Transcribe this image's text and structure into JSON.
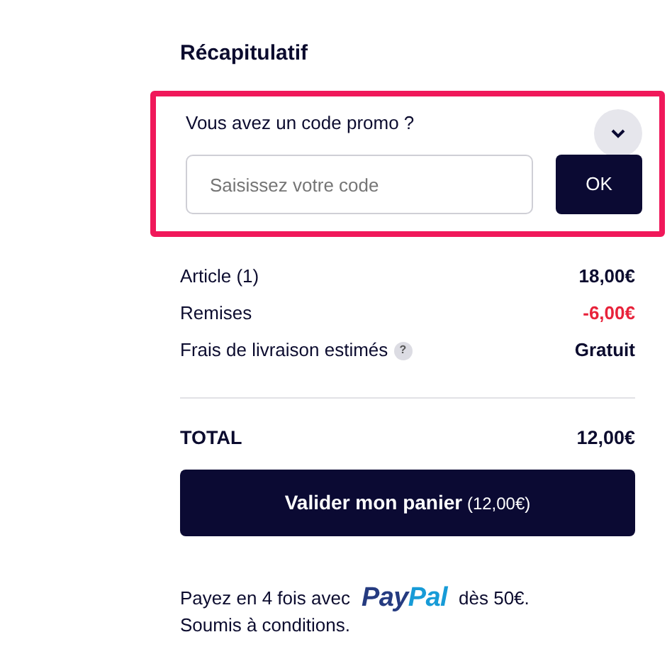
{
  "title": "Récapitulatif",
  "promo": {
    "label": "Vous avez un code promo ?",
    "expanded": true,
    "placeholder": "Saisissez votre code",
    "button": "OK",
    "highlighted": true
  },
  "rows": [
    {
      "kind": "normal",
      "label": "Article (1)",
      "value": "18,00€"
    },
    {
      "kind": "discount",
      "label": "Remises",
      "value": "-6,00€"
    },
    {
      "kind": "info",
      "label": "Frais de livraison estimés",
      "help": "?",
      "value": "Gratuit"
    }
  ],
  "total": {
    "label": "TOTAL",
    "value": "12,00€"
  },
  "checkout_button": "**Valider mon panier** (12,00€)",
  "paypal": {
    "before": "Payez en 4 fois avec",
    "logo": [
      "Pay",
      "Pal"
    ],
    "after": "dès 50€.",
    "note": "Soumis à conditions."
  }
}
